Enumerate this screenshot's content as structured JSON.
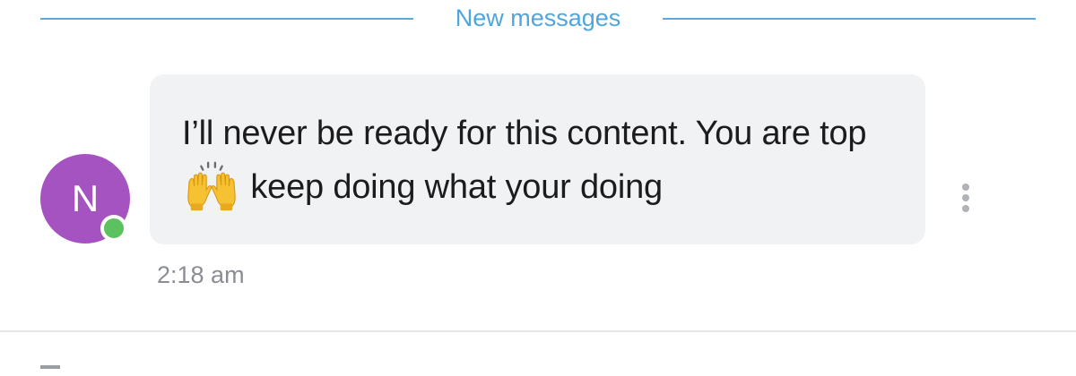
{
  "divider": {
    "label": "New messages",
    "color": "#58a9dc"
  },
  "sender": {
    "initial": "N",
    "avatar_color": "#a653c2",
    "presence": "online",
    "presence_color": "#5bc25f"
  },
  "message": {
    "text_before_emoji": "I’ll never be ready for this content. You are top",
    "emoji": "raising-hands",
    "text_after_emoji": "keep doing what your doing",
    "timestamp": "2:18 am",
    "bubble_color": "#f1f2f4"
  },
  "actions": {
    "more_icon": "more-vertical-icon"
  }
}
